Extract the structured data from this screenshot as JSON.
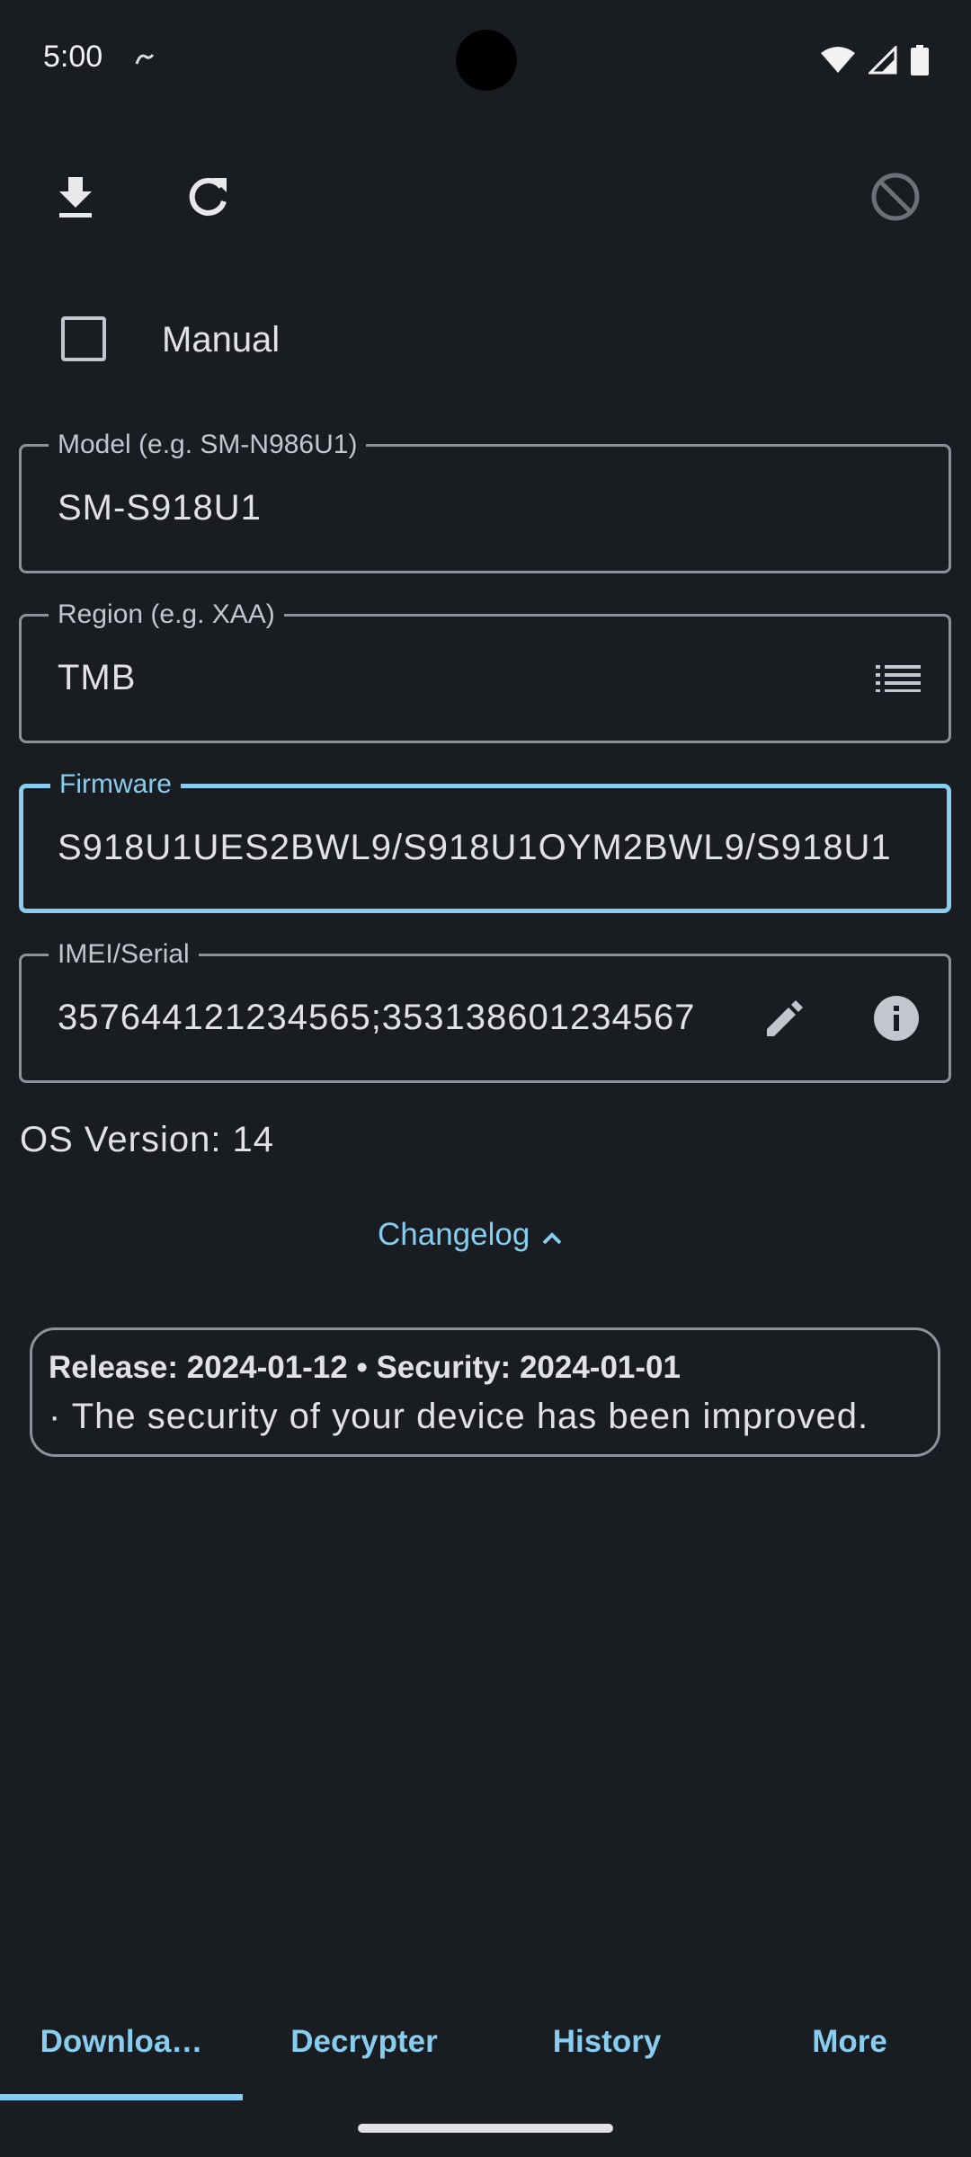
{
  "status_bar": {
    "time": "5:00",
    "icons": [
      "notification-icon",
      "wifi-icon",
      "signal-icon",
      "battery-icon"
    ]
  },
  "toolbar": {
    "icons": [
      "download-icon",
      "refresh-icon",
      "cancel-icon"
    ]
  },
  "manual": {
    "label": "Manual",
    "checked": false
  },
  "fields": {
    "model": {
      "label": "Model (e.g. SM-N986U1)",
      "value": "SM-S918U1"
    },
    "region": {
      "label": "Region (e.g. XAA)",
      "value": "TMB",
      "icon": "list-icon"
    },
    "firmware": {
      "label": "Firmware",
      "value": "S918U1UES2BWL9/S918U1OYM2BWL9/S918U1"
    },
    "imei": {
      "label": "IMEI/Serial",
      "value": "357644121234565;353138601234567",
      "icons": [
        "edit-icon",
        "info-icon"
      ]
    }
  },
  "os_version": "OS Version: 14",
  "changelog": {
    "button_label": "Changelog",
    "header": "Release: 2024-01-12  •  Security: 2024-01-01",
    "body": "· The security of your device has been improved."
  },
  "tabs": [
    {
      "label": "Downloa…",
      "active": true
    },
    {
      "label": "Decrypter",
      "active": false
    },
    {
      "label": "History",
      "active": false
    },
    {
      "label": "More",
      "active": false
    }
  ],
  "colors": {
    "background": "#191c20",
    "accent": "#86cdef",
    "outline": "#8d9199",
    "text": "#e2e2e6"
  }
}
